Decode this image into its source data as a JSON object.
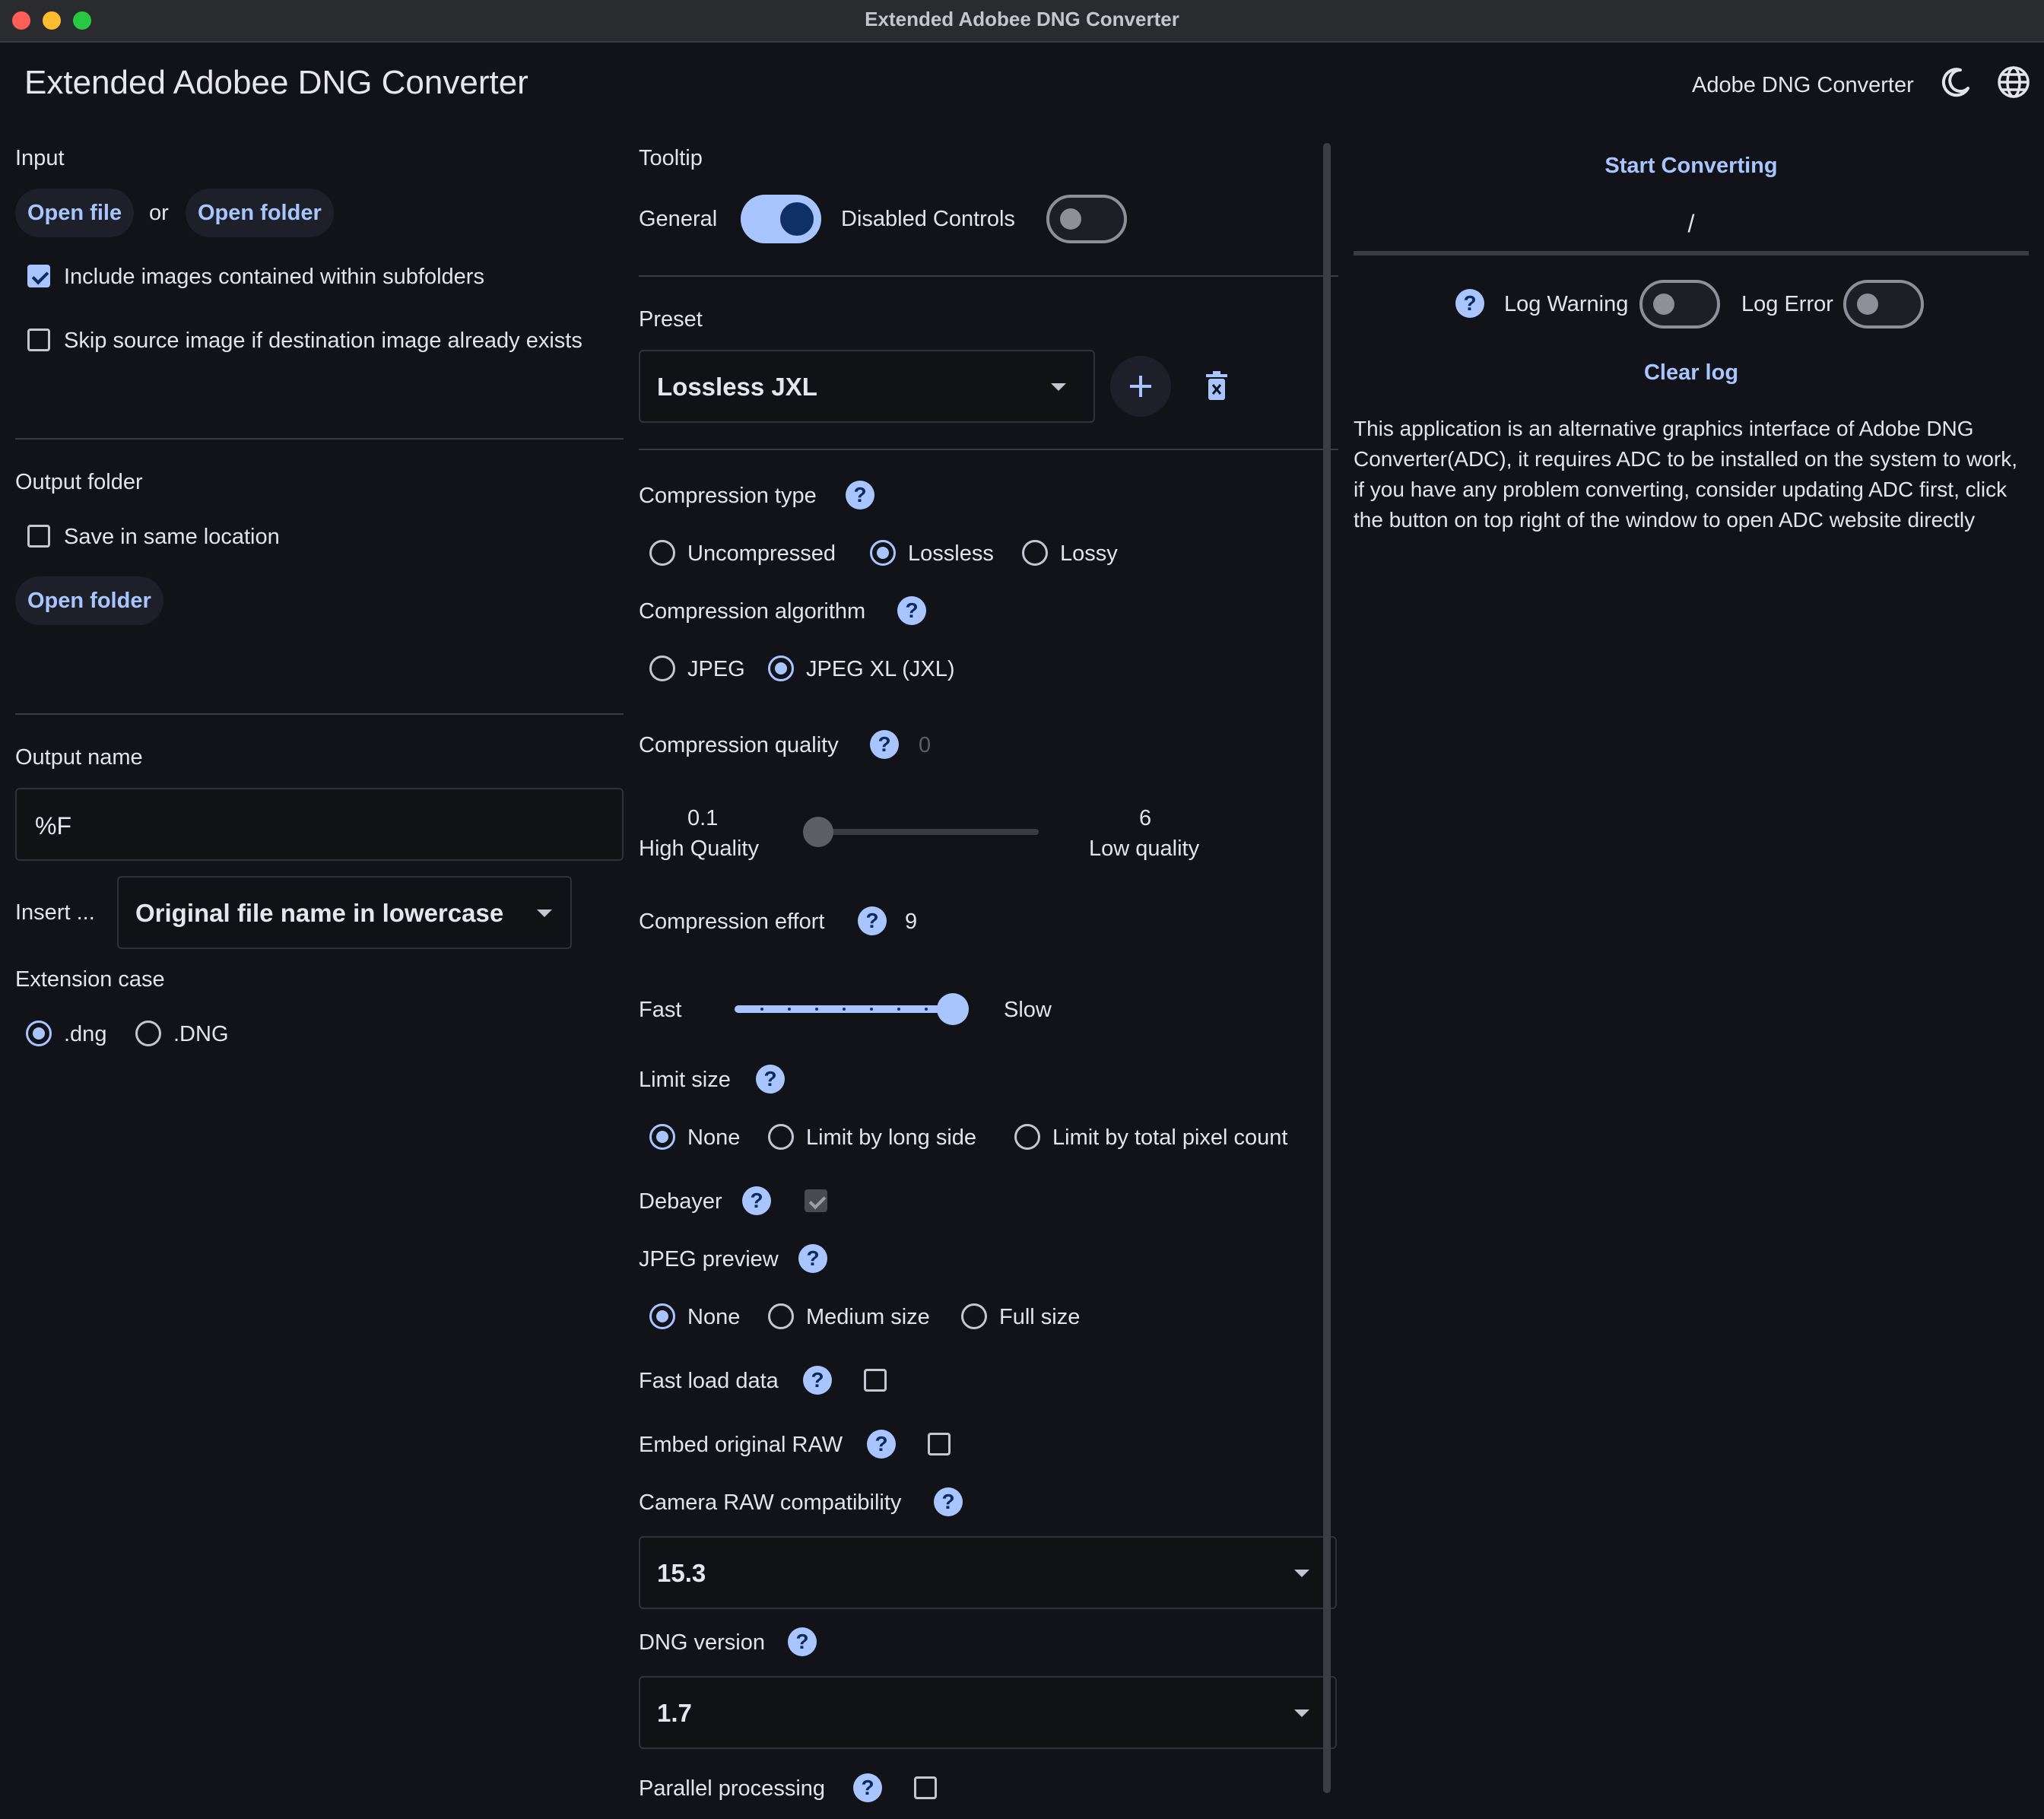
{
  "window": {
    "title": "Extended Adobee DNG Converter"
  },
  "header": {
    "app_title": "Extended Adobee DNG Converter",
    "adc_link": "Adobe DNG Converter"
  },
  "input": {
    "label": "Input",
    "open_file": "Open file",
    "or": "or",
    "open_folder": "Open folder",
    "include_subfolders": {
      "label": "Include images contained within subfolders",
      "checked": true
    },
    "skip_existing": {
      "label": "Skip source image if destination image already exists",
      "checked": false
    }
  },
  "output_folder": {
    "label": "Output folder",
    "same_location": {
      "label": "Save in same location",
      "checked": false
    },
    "open_folder": "Open folder"
  },
  "output_name": {
    "label": "Output name",
    "value": "%F",
    "insert_label": "Insert ...",
    "insert_selected": "Original file name in lowercase"
  },
  "extension_case": {
    "label": "Extension case",
    "options": [
      ".dng",
      ".DNG"
    ],
    "selected": ".dng"
  },
  "tooltip": {
    "label": "Tooltip",
    "general": {
      "label": "General",
      "on": true
    },
    "disabled_controls": {
      "label": "Disabled Controls",
      "on": false
    }
  },
  "preset": {
    "label": "Preset",
    "selected": "Lossless JXL"
  },
  "compression_type": {
    "label": "Compression type",
    "options": [
      "Uncompressed",
      "Lossless",
      "Lossy"
    ],
    "selected": "Lossless"
  },
  "compression_algorithm": {
    "label": "Compression algorithm",
    "options": [
      "JPEG",
      "JPEG XL (JXL)"
    ],
    "selected": "JPEG XL (JXL)"
  },
  "compression_quality": {
    "label": "Compression quality",
    "value": "0",
    "min_value": "0.1",
    "min_label": "High Quality",
    "max_value": "6",
    "max_label": "Low quality",
    "slider_fraction": 0
  },
  "compression_effort": {
    "label": "Compression effort",
    "value": "9",
    "min_label": "Fast",
    "max_label": "Slow",
    "slider_fraction": 1
  },
  "limit_size": {
    "label": "Limit size",
    "options": [
      "None",
      "Limit by long side",
      "Limit by total pixel count"
    ],
    "selected": "None"
  },
  "debayer": {
    "label": "Debayer",
    "checked": true,
    "disabled": true
  },
  "jpeg_preview": {
    "label": "JPEG preview",
    "options": [
      "None",
      "Medium size",
      "Full size"
    ],
    "selected": "None"
  },
  "fast_load_data": {
    "label": "Fast load data",
    "checked": false
  },
  "embed_original_raw": {
    "label": "Embed original RAW",
    "checked": false
  },
  "camera_raw_compat": {
    "label": "Camera RAW compatibility",
    "selected": "15.3"
  },
  "dng_version": {
    "label": "DNG version",
    "selected": "1.7"
  },
  "parallel_processing": {
    "label": "Parallel processing",
    "checked": false
  },
  "right_panel": {
    "start_converting": "Start Converting",
    "progress_text": "/",
    "log_warning": {
      "label": "Log Warning",
      "on": false
    },
    "log_error": {
      "label": "Log Error",
      "on": false
    },
    "clear_log": "Clear log",
    "description": "This application is an alternative graphics interface of Adobe DNG Converter(ADC), it requires ADC to be installed on the system to work, if you have any problem converting, consider updating ADC first, click the button on top right of the window to open ADC website directly"
  },
  "help_icon_glyph": "?",
  "colors": {
    "accent": "#a8c5ff",
    "background": "#121318"
  }
}
